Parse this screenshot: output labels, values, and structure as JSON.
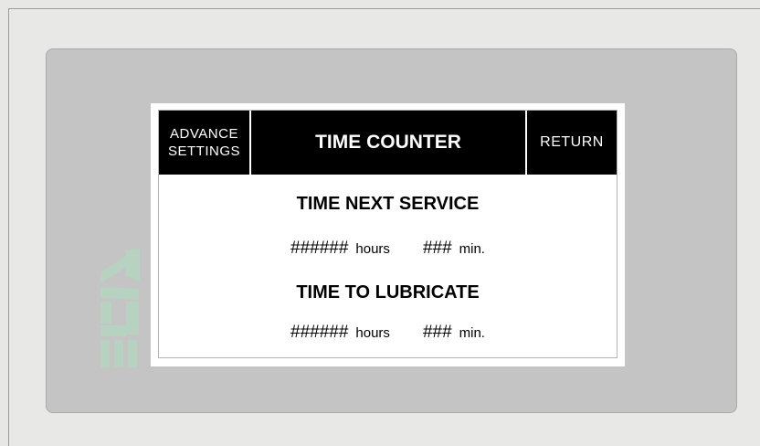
{
  "header": {
    "advance_settings_line1": "ADVANCE",
    "advance_settings_line2": "SETTINGS",
    "title": "TIME COUNTER",
    "return_label": "RETURN"
  },
  "service": {
    "title": "TIME NEXT SERVICE",
    "hours_value": "######",
    "hours_unit": "hours",
    "min_value": "###",
    "min_unit": "min."
  },
  "lubricate": {
    "title": "TIME TO LUBRICATE",
    "hours_value": "######",
    "hours_unit": "hours",
    "min_value": "###",
    "min_unit": "min."
  },
  "colors": {
    "header_bg": "#000000",
    "bezel": "#c4c4c4",
    "background": "#e7e7e6",
    "logo": "#b8d2c2"
  }
}
